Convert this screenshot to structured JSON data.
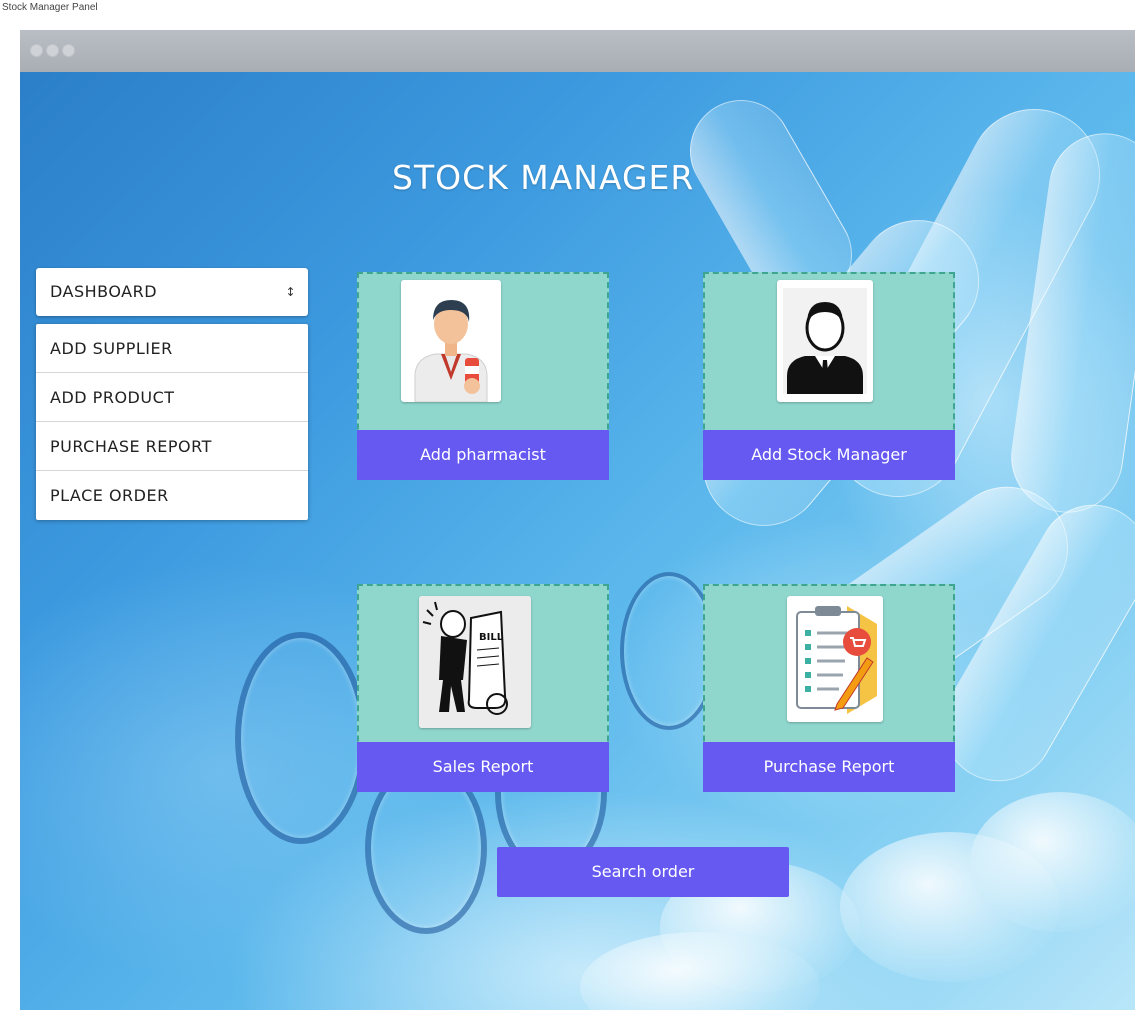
{
  "caption": "Stock Manager Panel",
  "app_title": "STOCK MANAGER",
  "sidebar": {
    "select_value": "DASHBOARD",
    "items": [
      {
        "label": "ADD SUPPLIER"
      },
      {
        "label": "ADD PRODUCT"
      },
      {
        "label": "PURCHASE REPORT"
      },
      {
        "label": "PLACE ORDER"
      }
    ]
  },
  "cards": {
    "add_pharmacist": {
      "label": "Add pharmacist",
      "icon": "pharmacist-icon"
    },
    "add_stock_manager": {
      "label": "Add Stock Manager",
      "icon": "manager-icon"
    },
    "sales_report": {
      "label": "Sales Report",
      "icon": "bill-icon"
    },
    "purchase_report": {
      "label": "Purchase Report",
      "icon": "checklist-icon"
    }
  },
  "search_order": {
    "label": "Search order"
  },
  "colors": {
    "card_bg": "#8fd6cd",
    "card_border": "#3ea591",
    "button_bg": "#6559f2",
    "title": "#ffffff"
  }
}
